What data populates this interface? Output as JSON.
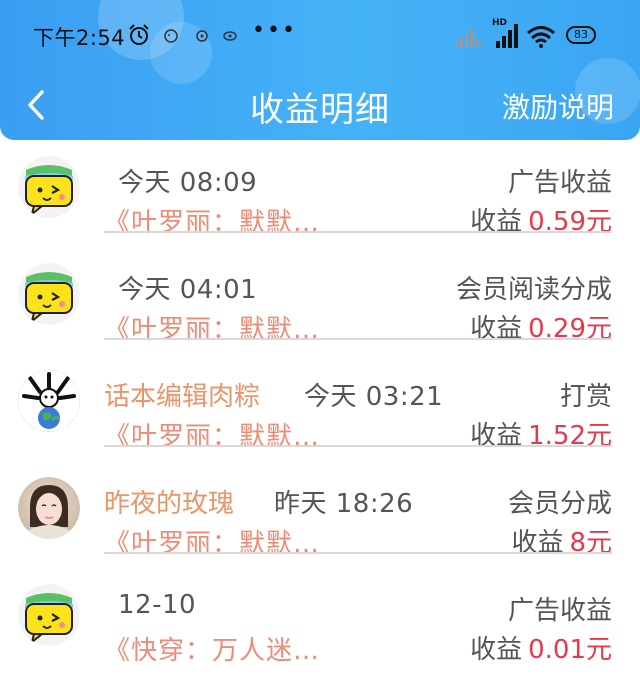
{
  "status_bar": {
    "time": "下午2:54",
    "network_hd": "HD",
    "battery": "83"
  },
  "header": {
    "title": "收益明细",
    "help": "激励说明",
    "back_icon": "chevron-left-icon"
  },
  "colors": {
    "header_bg": "#3a9ef2",
    "name": "#eb9468",
    "book": "#f08a74",
    "amount": "#e8384b",
    "text": "#555555"
  },
  "records": [
    {
      "avatar": "yellow-chat-bubble-avatar",
      "name": "",
      "time": "今天 08:09",
      "type": "广告收益",
      "book": "《叶罗丽：默默…",
      "earning_label": "收益",
      "amount": "0.59元"
    },
    {
      "avatar": "yellow-chat-bubble-avatar",
      "name": "",
      "time": "今天 04:01",
      "type": "会员阅读分成",
      "book": "《叶罗丽：默默…",
      "earning_label": "收益",
      "amount": "0.29元"
    },
    {
      "avatar": "bone-globe-avatar",
      "name": "话本编辑肉粽",
      "time": "今天 03:21",
      "type": "打赏",
      "book": "《叶罗丽：默默…",
      "earning_label": "收益",
      "amount": "1.52元"
    },
    {
      "avatar": "girl-photo-avatar",
      "name": "昨夜的玫瑰",
      "time": "昨天 18:26",
      "type": "会员分成",
      "book": "《叶罗丽：默默…",
      "earning_label": "收益",
      "amount": "8元"
    },
    {
      "avatar": "yellow-chat-bubble-avatar",
      "name": "",
      "time": "12-10",
      "type": "广告收益",
      "book": "《快穿：万人迷…",
      "earning_label": "收益",
      "amount": "0.01元"
    }
  ]
}
